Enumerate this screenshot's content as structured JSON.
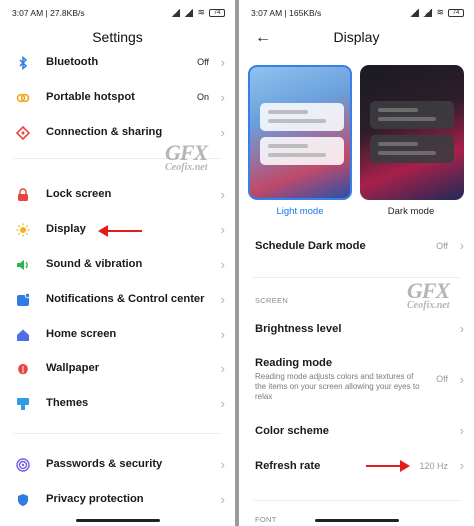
{
  "left": {
    "status": {
      "time": "3:07 AM | 27.8KB/s",
      "battery": "74"
    },
    "title": "Settings",
    "items": [
      {
        "label": "Bluetooth",
        "value": "Off",
        "icon": "bluetooth-icon",
        "color": "#2f7de1"
      },
      {
        "label": "Portable hotspot",
        "value": "On",
        "icon": "hotspot-icon",
        "color": "#f2a51a"
      },
      {
        "label": "Connection & sharing",
        "value": "",
        "icon": "connection-sharing-icon",
        "color": "#e8473d"
      },
      {
        "label": "Lock screen",
        "value": "",
        "icon": "lock-icon",
        "color": "#e8473d"
      },
      {
        "label": "Display",
        "value": "",
        "icon": "sun-icon",
        "color": "#f2b21a"
      },
      {
        "label": "Sound & vibration",
        "value": "",
        "icon": "speaker-icon",
        "color": "#2fb34a"
      },
      {
        "label": "Notifications & Control center",
        "value": "",
        "icon": "notifications-icon",
        "color": "#2f7de1"
      },
      {
        "label": "Home screen",
        "value": "",
        "icon": "home-icon",
        "color": "#4f6ee6"
      },
      {
        "label": "Wallpaper",
        "value": "",
        "icon": "wallpaper-icon",
        "color": "#e8473d"
      },
      {
        "label": "Themes",
        "value": "",
        "icon": "themes-icon",
        "color": "#2f9de6"
      },
      {
        "label": "Passwords & security",
        "value": "",
        "icon": "fingerprint-icon",
        "color": "#7a5ce6"
      },
      {
        "label": "Privacy protection",
        "value": "",
        "icon": "privacy-icon",
        "color": "#2f7de1"
      }
    ],
    "watermark": {
      "logo": "GFX",
      "site": "Ceofix.net"
    }
  },
  "right": {
    "status": {
      "time": "3:07 AM | 165KB/s",
      "battery": "74"
    },
    "title": "Display",
    "themes": {
      "light_label": "Light mode",
      "dark_label": "Dark mode",
      "light_color": "#1a73e8"
    },
    "schedule": {
      "label": "Schedule Dark mode",
      "value": "Off"
    },
    "screen_section": "SCREEN",
    "brightness": {
      "label": "Brightness level"
    },
    "reading": {
      "label": "Reading mode",
      "desc": "Reading mode adjusts colors and textures of the items on your screen allowing your eyes to relax",
      "value": "Off"
    },
    "color_scheme": {
      "label": "Color scheme"
    },
    "refresh": {
      "label": "Refresh rate",
      "value": "120 Hz"
    },
    "font_section": "FONT",
    "watermark": {
      "logo": "GFX",
      "site": "Ceofix.net"
    }
  }
}
